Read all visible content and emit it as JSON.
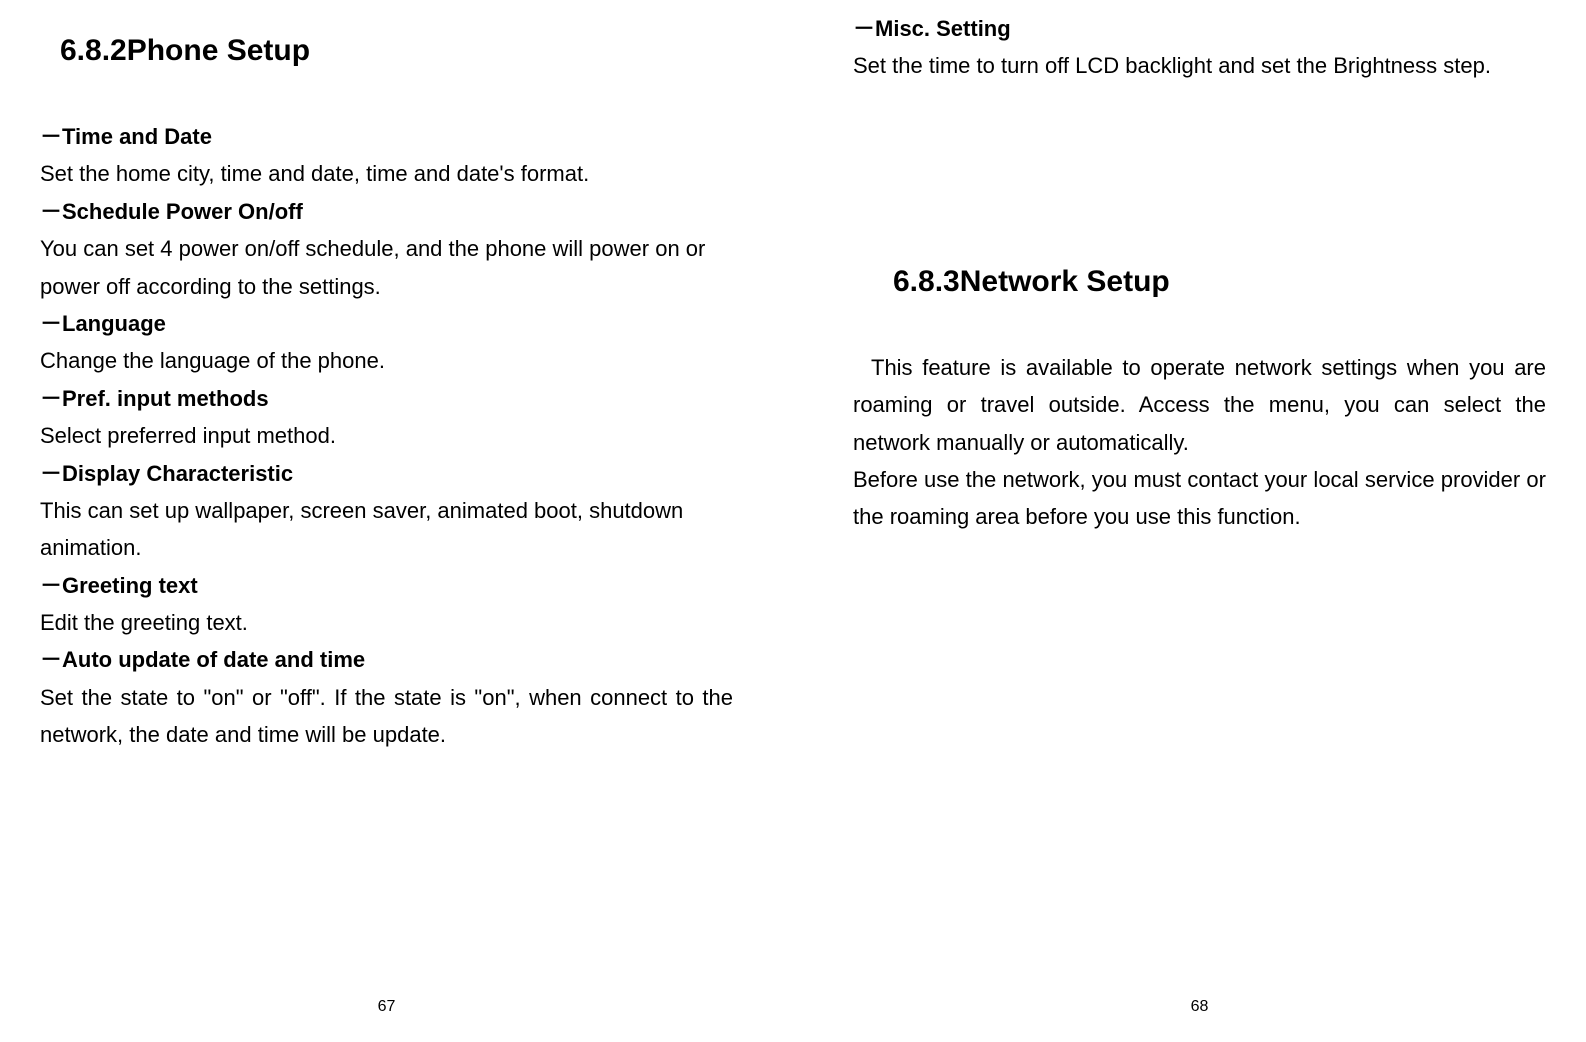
{
  "leftPage": {
    "title": "6.8.2Phone Setup",
    "items": [
      {
        "heading": "－Time and Date",
        "body": "Set the home city, time and date, time and date's format.",
        "justify": true
      },
      {
        "heading": "－Schedule Power On/off",
        "body": "You can set 4 power on/off schedule, and the phone will power on or power off according to the settings.",
        "justify": false
      },
      {
        "heading": "－Language",
        "body": "Change the language of the phone.",
        "justify": false
      },
      {
        "heading": "－Pref. input methods",
        "body": "Select preferred input method.",
        "justify": false
      },
      {
        "heading": "－Display Characteristic",
        "body": "This can set up wallpaper, screen saver, animated boot, shutdown animation.",
        "justify": false
      },
      {
        "heading": "－Greeting text",
        "body": "Edit the greeting text.",
        "justify": false
      },
      {
        "heading": "－Auto update of date and time",
        "body": "Set the state to \"on\" or \"off\". If the state is \"on\", when connect to the network, the date and time will be update.",
        "justify": true
      }
    ],
    "pageNumber": "67"
  },
  "rightPage": {
    "topItem": {
      "heading": "－Misc. Setting",
      "body": "Set the time to turn off LCD backlight and set the Brightness step."
    },
    "title": "6.8.3Network Setup",
    "para1": "This feature is available to operate network settings when you are roaming or travel outside. Access the menu, you can select the network manually or automatically.",
    "para2": "Before use the network, you must contact your local service provider or the roaming area before you use this function.",
    "pageNumber": "68"
  }
}
